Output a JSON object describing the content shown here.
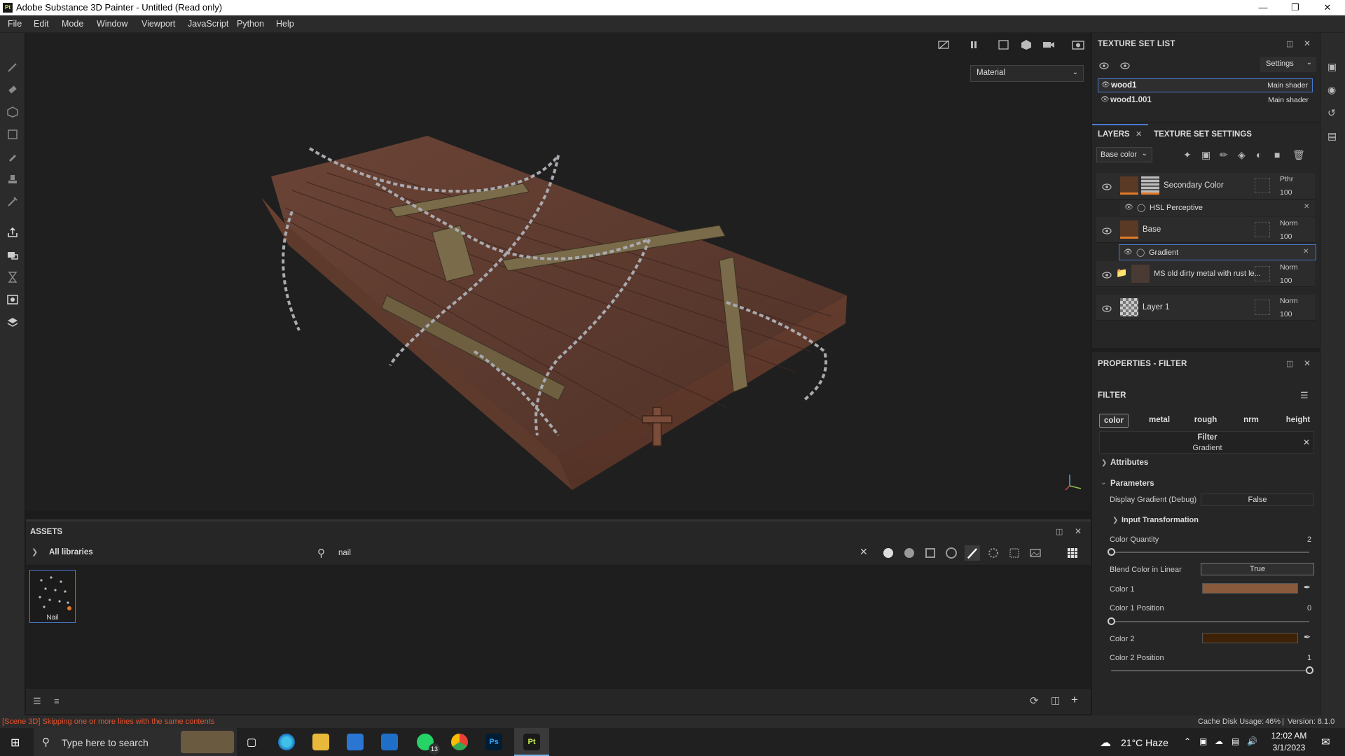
{
  "window": {
    "title": "Adobe Substance 3D Painter - Untitled (Read only)",
    "app_badge": "Pt"
  },
  "menu": [
    "File",
    "Edit",
    "Mode",
    "Window",
    "Viewport",
    "JavaScript",
    "Python",
    "Help"
  ],
  "viewport": {
    "material_mode": "Material"
  },
  "texture_set_list": {
    "title": "TEXTURE SET LIST",
    "settings_label": "Settings",
    "items": [
      {
        "name": "wood1",
        "shader": "Main shader",
        "selected": true
      },
      {
        "name": "wood1.001",
        "shader": "Main shader",
        "selected": false
      }
    ]
  },
  "layers_panel": {
    "tab_layers": "LAYERS",
    "tab_tss": "TEXTURE SET SETTINGS",
    "channel": "Base color",
    "layers": [
      {
        "name": "Secondary Color",
        "blend": "Pthr",
        "opacity": "100",
        "effect": "HSL Perceptive"
      },
      {
        "name": "Base",
        "blend": "Norm",
        "opacity": "100",
        "effect": "Gradient"
      },
      {
        "name": "MS old dirty metal with rust le...",
        "blend": "Norm",
        "opacity": "100"
      },
      {
        "name": "Layer 1",
        "blend": "Norm",
        "opacity": "100"
      }
    ]
  },
  "properties": {
    "title": "PROPERTIES - FILTER",
    "section": "FILTER",
    "channels": [
      "color",
      "metal",
      "rough",
      "nrm",
      "height"
    ],
    "active_channel": "color",
    "filter_label": "Filter",
    "filter_name": "Gradient",
    "attributes": "Attributes",
    "parameters": "Parameters",
    "display_gradient_label": "Display Gradient (Debug)",
    "display_gradient_value": "False",
    "input_transformation": "Input Transformation",
    "color_quantity_label": "Color Quantity",
    "color_quantity_value": "2",
    "color_quantity_fraction": 0.0,
    "blend_linear_label": "Blend Color in Linear",
    "blend_linear_value": "True",
    "color1_label": "Color 1",
    "color1": "#8a5a3c",
    "color1_pos_label": "Color 1 Position",
    "color1_pos_value": "0",
    "color1_pos_fraction": 0.0,
    "color2_label": "Color 2",
    "color2": "#3e2208",
    "color2_pos_label": "Color 2 Position",
    "color2_pos_value": "1",
    "color2_pos_fraction": 1.0
  },
  "assets": {
    "title": "ASSETS",
    "library": "All libraries",
    "search_value": "nail",
    "items": [
      {
        "name": "Nail"
      }
    ]
  },
  "status": {
    "message": "[Scene 3D] Skipping one or more lines with the same contents",
    "cache": "Cache Disk Usage:",
    "cache_value": "46%",
    "version": "Version: 8.1.0"
  },
  "taskbar": {
    "search_placeholder": "Type here to search",
    "weather": "21°C  Haze",
    "time": "12:02 AM",
    "date": "3/1/2023",
    "whatsapp_badge": "13"
  }
}
